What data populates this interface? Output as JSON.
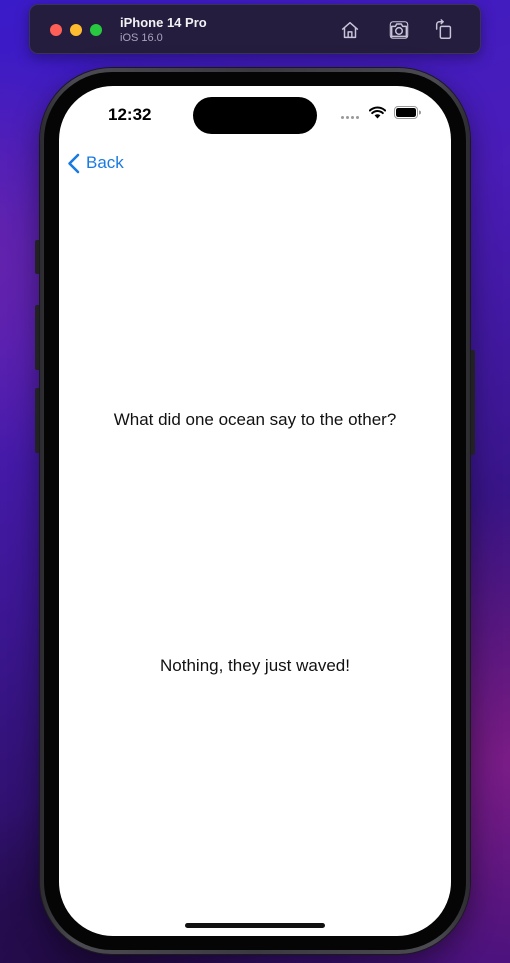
{
  "simulator": {
    "device_name": "iPhone 14 Pro",
    "os_version": "iOS 16.0",
    "buttons": {
      "home_icon": "house-icon",
      "screenshot_icon": "camera-icon",
      "rotate_icon": "rotate-icon"
    }
  },
  "status_bar": {
    "time": "12:32",
    "icons": [
      "signal-icon",
      "wifi-icon",
      "battery-icon"
    ]
  },
  "navigation": {
    "back_label": "Back",
    "back_icon": "chevron-left-icon"
  },
  "content": {
    "question": "What did one ocean say to the other?",
    "answer": "Nothing, they just waved!"
  },
  "colors": {
    "accent": "#1a7ae0",
    "screen_background": "#ffffff",
    "text": "#111111"
  }
}
